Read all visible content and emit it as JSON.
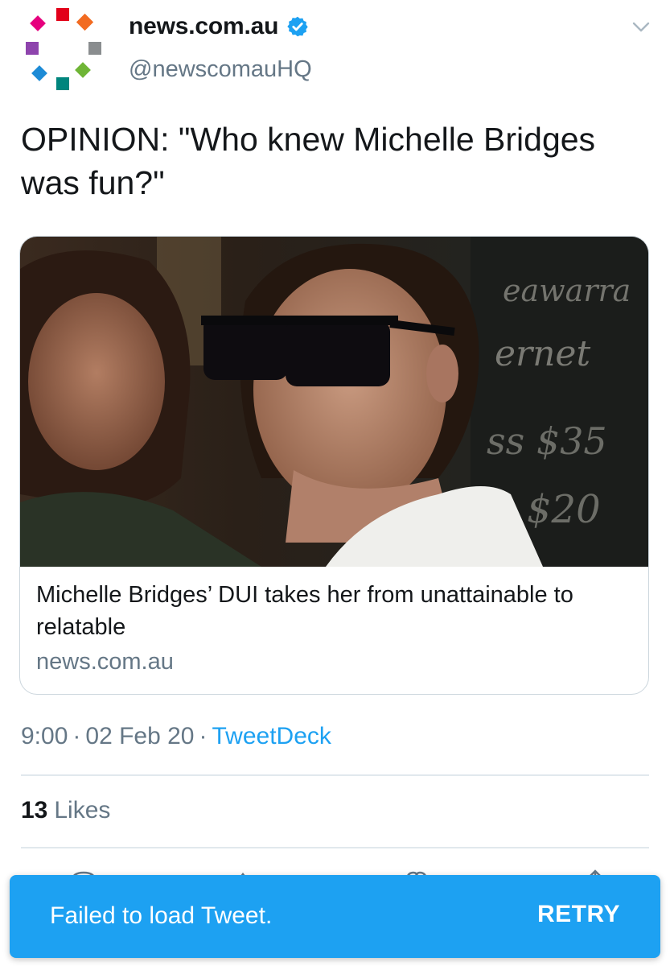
{
  "account": {
    "display_name": "news.com.au",
    "handle": "@newscomauHQ",
    "verified": true,
    "avatar_icon": "newscomau-logo-icon",
    "menu_icon": "chevron-down-icon"
  },
  "tweet": {
    "text": "OPINION: \"Who knew Michelle Bridges was fun?\"",
    "time": "9:00",
    "date": "02 Feb 20",
    "source": "TweetDeck",
    "separator": "·"
  },
  "card": {
    "title": "Michelle Bridges’ DUI takes her from unattainable to relatable",
    "domain": "news.com.au",
    "image_icon": "article-photo"
  },
  "stats": {
    "likes_count": "13",
    "likes_label": "Likes"
  },
  "actions": {
    "icons": [
      "reply-icon",
      "retweet-icon",
      "like-icon",
      "share-icon"
    ]
  },
  "snackbar": {
    "message": "Failed to load Tweet.",
    "action_label": "RETRY"
  },
  "colors": {
    "accent": "#1da1f2",
    "text_primary": "#14171a",
    "text_secondary": "#657786",
    "border": "#e1e8ed"
  }
}
